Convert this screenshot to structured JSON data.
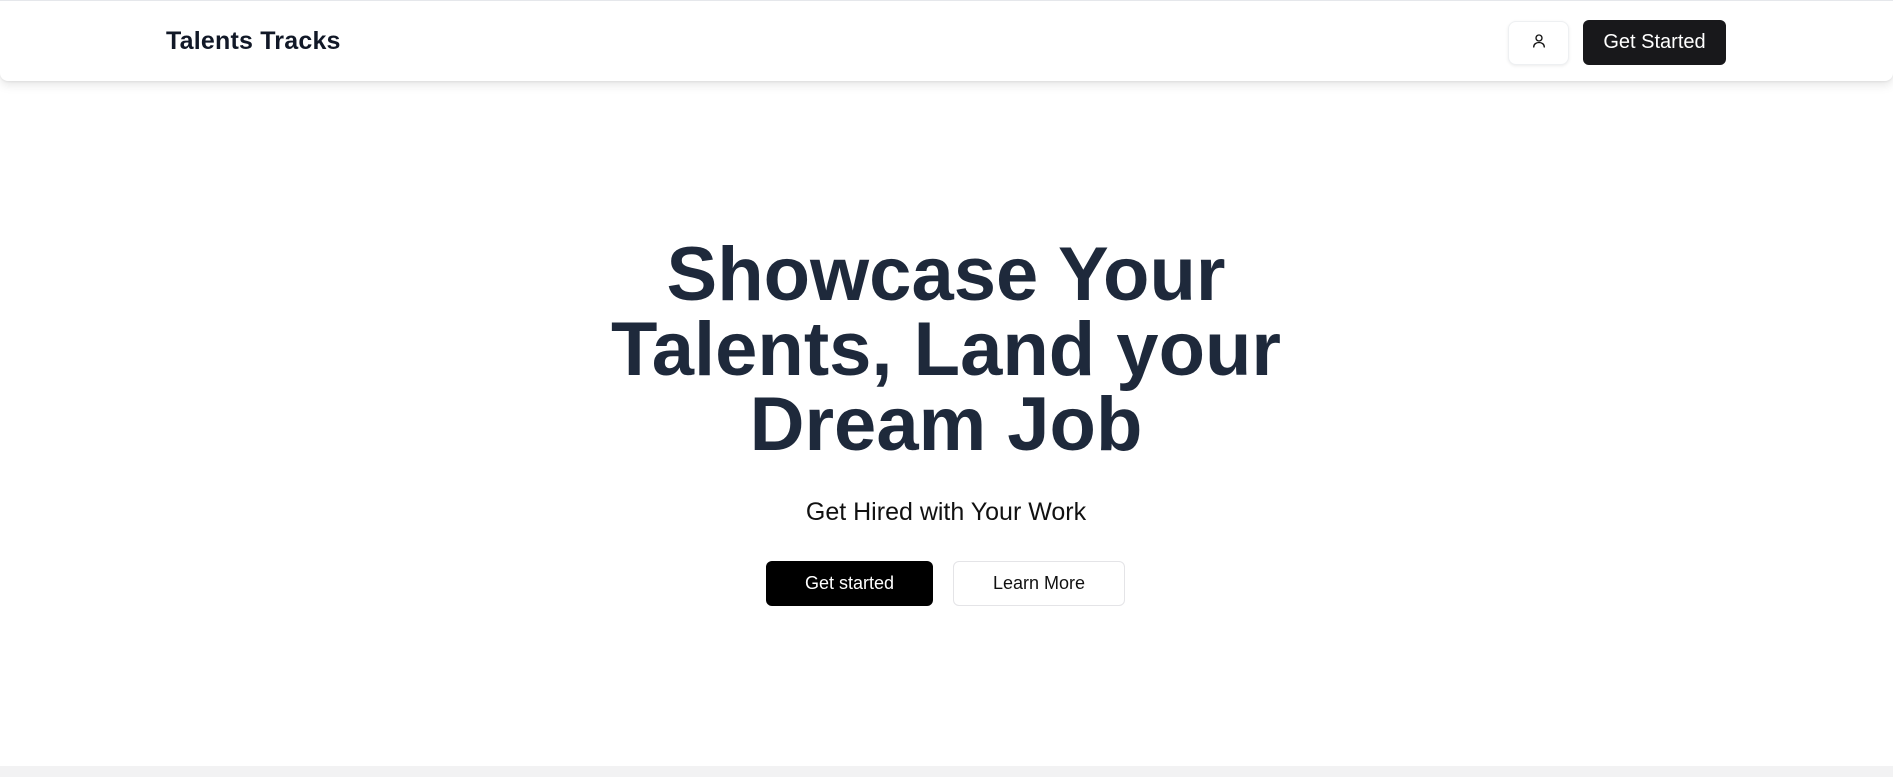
{
  "navbar": {
    "brand": "Talents Tracks",
    "profile_icon": "user-icon",
    "cta_label": "Get Started"
  },
  "hero": {
    "title": "Showcase Your Talents, Land your Dream Job",
    "subtitle": "Get Hired with Your Work",
    "primary_label": "Get started",
    "secondary_label": "Learn More"
  },
  "colors": {
    "heading": "#1e293b",
    "primary_button": "#000000",
    "nav_button": "#18181b",
    "background": "#ffffff"
  }
}
